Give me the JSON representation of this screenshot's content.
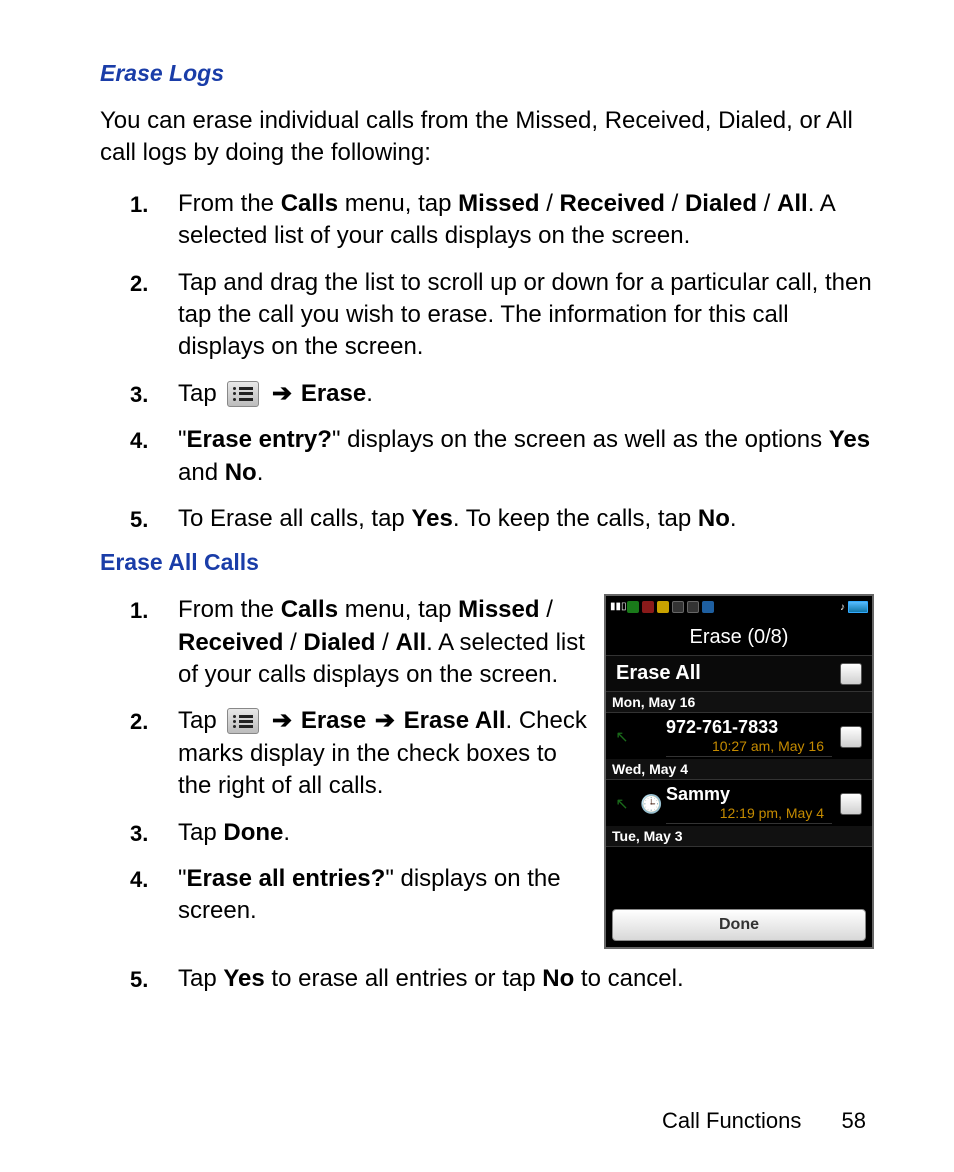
{
  "section1": {
    "title": "Erase Logs",
    "intro": "You can erase individual calls from the Missed, Received, Dialed, or All call logs by doing the following:",
    "items": [
      {
        "num": "1.",
        "pre": "From the ",
        "b1": "Calls",
        "mid1": " menu, tap ",
        "b2": "Missed",
        "s1": " / ",
        "b3": "Received",
        "s2": " / ",
        "b4": "Dialed",
        "s3": " / ",
        "b5": "All",
        "tail": ". A selected list of your calls displays on the screen."
      },
      {
        "num": "2.",
        "text": "Tap and drag the list to scroll up or down for a particular call, then tap the call you wish to erase. The information for this call displays on the screen."
      },
      {
        "num": "3.",
        "pre": "Tap ",
        "arrow": "➔",
        "b1": "Erase",
        "tail": "."
      },
      {
        "num": "4.",
        "q1": "\"",
        "b1": "Erase entry?",
        "q2": "\" displays on the screen as well as the options ",
        "b2": "Yes",
        "mid": " and ",
        "b3": "No",
        "tail": "."
      },
      {
        "num": "5.",
        "pre": "To Erase all calls, tap ",
        "b1": "Yes",
        "mid": ". To keep the calls, tap ",
        "b2": "No",
        "tail": "."
      }
    ]
  },
  "section2": {
    "title": "Erase All Calls",
    "items": [
      {
        "num": "1.",
        "pre": "From the ",
        "b1": "Calls",
        "mid1": " menu, tap ",
        "b2": "Missed",
        "s1": " / ",
        "b3": "Received",
        "s2": " / ",
        "b4": "Dialed",
        "s3": " / ",
        "b5": "All",
        "tail": ". A selected list of your calls displays on the screen."
      },
      {
        "num": "2.",
        "pre": "Tap ",
        "arrow": "➔",
        "b1": "Erase",
        "arrow2": "➔",
        "b2": "Erase All",
        "tail": ". Check marks display in the check boxes to the right of all calls."
      },
      {
        "num": "3.",
        "pre": "Tap ",
        "b1": "Done",
        "tail": "."
      },
      {
        "num": "4.",
        "q1": "\"",
        "b1": "Erase all entries?",
        "q2": "\" displays on the screen."
      },
      {
        "num": "5.",
        "pre": "Tap ",
        "b1": "Yes",
        "mid": " to erase all entries or tap ",
        "b2": "No",
        "tail": " to cancel."
      }
    ]
  },
  "phone": {
    "title": "Erase (0/8)",
    "erase_all": "Erase All",
    "dates": [
      "Mon, May 16",
      "Wed, May 4",
      "Tue, May 3"
    ],
    "calls": [
      {
        "line1": "972-761-7833",
        "line2": "10:27 am, May 16"
      },
      {
        "line1": "Sammy",
        "line2": "12:19 pm, May 4"
      }
    ],
    "done": "Done",
    "signal": "▮▮▯"
  },
  "footer": {
    "label": "Call Functions",
    "page": "58"
  }
}
